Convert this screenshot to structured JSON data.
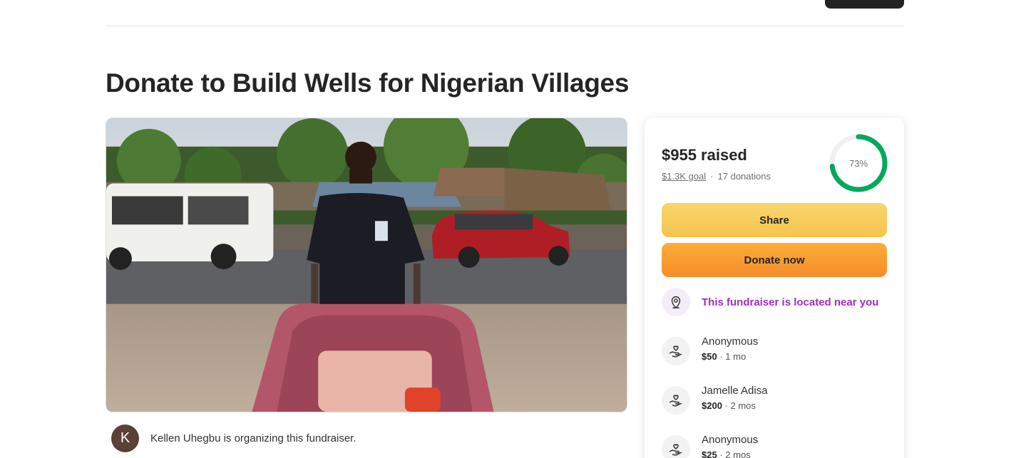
{
  "campaign": {
    "title": "Donate to Build Wells for Nigerian Villages",
    "organizer_initial": "K",
    "organizer_text": "Kellen Uhegbu is organizing this fundraiser."
  },
  "summary": {
    "raised": "$955 raised",
    "goal": "$1.3K goal",
    "separator": "·",
    "donations": "17 donations",
    "progress_label": "73%",
    "progress_fraction": 0.73,
    "progress_color": "#02a95c",
    "progress_track_color": "#f0f0f0"
  },
  "actions": {
    "share_label": "Share",
    "donate_label": "Donate now"
  },
  "location": {
    "text": "This fundraiser is located near you",
    "icon": "location-pin-icon",
    "color": "#a12ec0"
  },
  "donations": [
    {
      "name": "Anonymous",
      "amount": "$50",
      "time": "· 1 mo"
    },
    {
      "name": "Jamelle Adisa",
      "amount": "$200",
      "time": "· 2 mos"
    },
    {
      "name": "Anonymous",
      "amount": "$25",
      "time": "· 2 mos"
    }
  ]
}
